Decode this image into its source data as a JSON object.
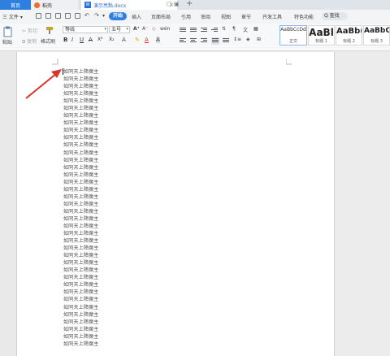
{
  "tabs": [
    {
      "label": "首页"
    },
    {
      "label": "稻壳"
    },
    {
      "label": "演示亮點.docx"
    }
  ],
  "tab_add": "+",
  "tab_close": "×",
  "menu": {
    "file": "三 文件 ▾",
    "items": [
      "开始",
      "插入",
      "页面布局",
      "引用",
      "审阅",
      "视图",
      "章节",
      "开发工具",
      "特色功能"
    ],
    "active": "开始",
    "search": "Q 查找"
  },
  "ribbon": {
    "paste": "粘贴",
    "cut": "剪切",
    "copy": "复制",
    "format_painter": "格式刷",
    "font_name": "等线",
    "font_size": "五号",
    "format_buttons": [
      "B",
      "I",
      "U",
      "A",
      "X²",
      "X₂",
      "A",
      "A",
      "A"
    ],
    "styles": [
      {
        "sample": "AaBbCcDd",
        "label": "正文"
      },
      {
        "sample": "AaBl",
        "label": "标题 1"
      },
      {
        "sample": "AaBb(",
        "label": "标题 2"
      },
      {
        "sample": "AaBbC",
        "label": "标题 3"
      }
    ]
  },
  "document": {
    "lines": [
      "如同天上降魔主",
      "如同天上降魔主",
      "如同天上降魔主",
      "如同天上降魔主",
      "如同天上降魔主",
      "如同天上降魔主",
      "如同天上降魔主",
      "如同天上降魔主",
      "如同天上降魔主",
      "如同天上降魔主",
      "如同天上降魔主",
      "如同天上降魔主",
      "如同天上降魔主",
      "如同天上降魔主",
      "如同天上降魔主",
      "如同天上降魔主",
      "如同天上降魔主",
      "如同天上降魔主",
      "如同天上降魔主",
      "如同天上降魔主",
      "如同天上降魔主",
      "如同天上降魔主",
      "如同天上降魔主",
      "如同天上降魔主",
      "如同天上降魔主",
      "如同天上降魔主",
      "如同天上降魔主",
      "如同天上降魔主",
      "如同天上降魔主",
      "如同天上降魔主",
      "如同天上降魔主",
      "如同天上降魔主",
      "如同天上降魔主",
      "如同天上降魔主",
      "如同天上降魔主",
      "如同天上降魔主",
      "如同天上降魔主",
      "如同天上降魔主"
    ]
  },
  "colors": {
    "accent": "#2f7fe0",
    "annotation_arrow": "#d9342b"
  }
}
